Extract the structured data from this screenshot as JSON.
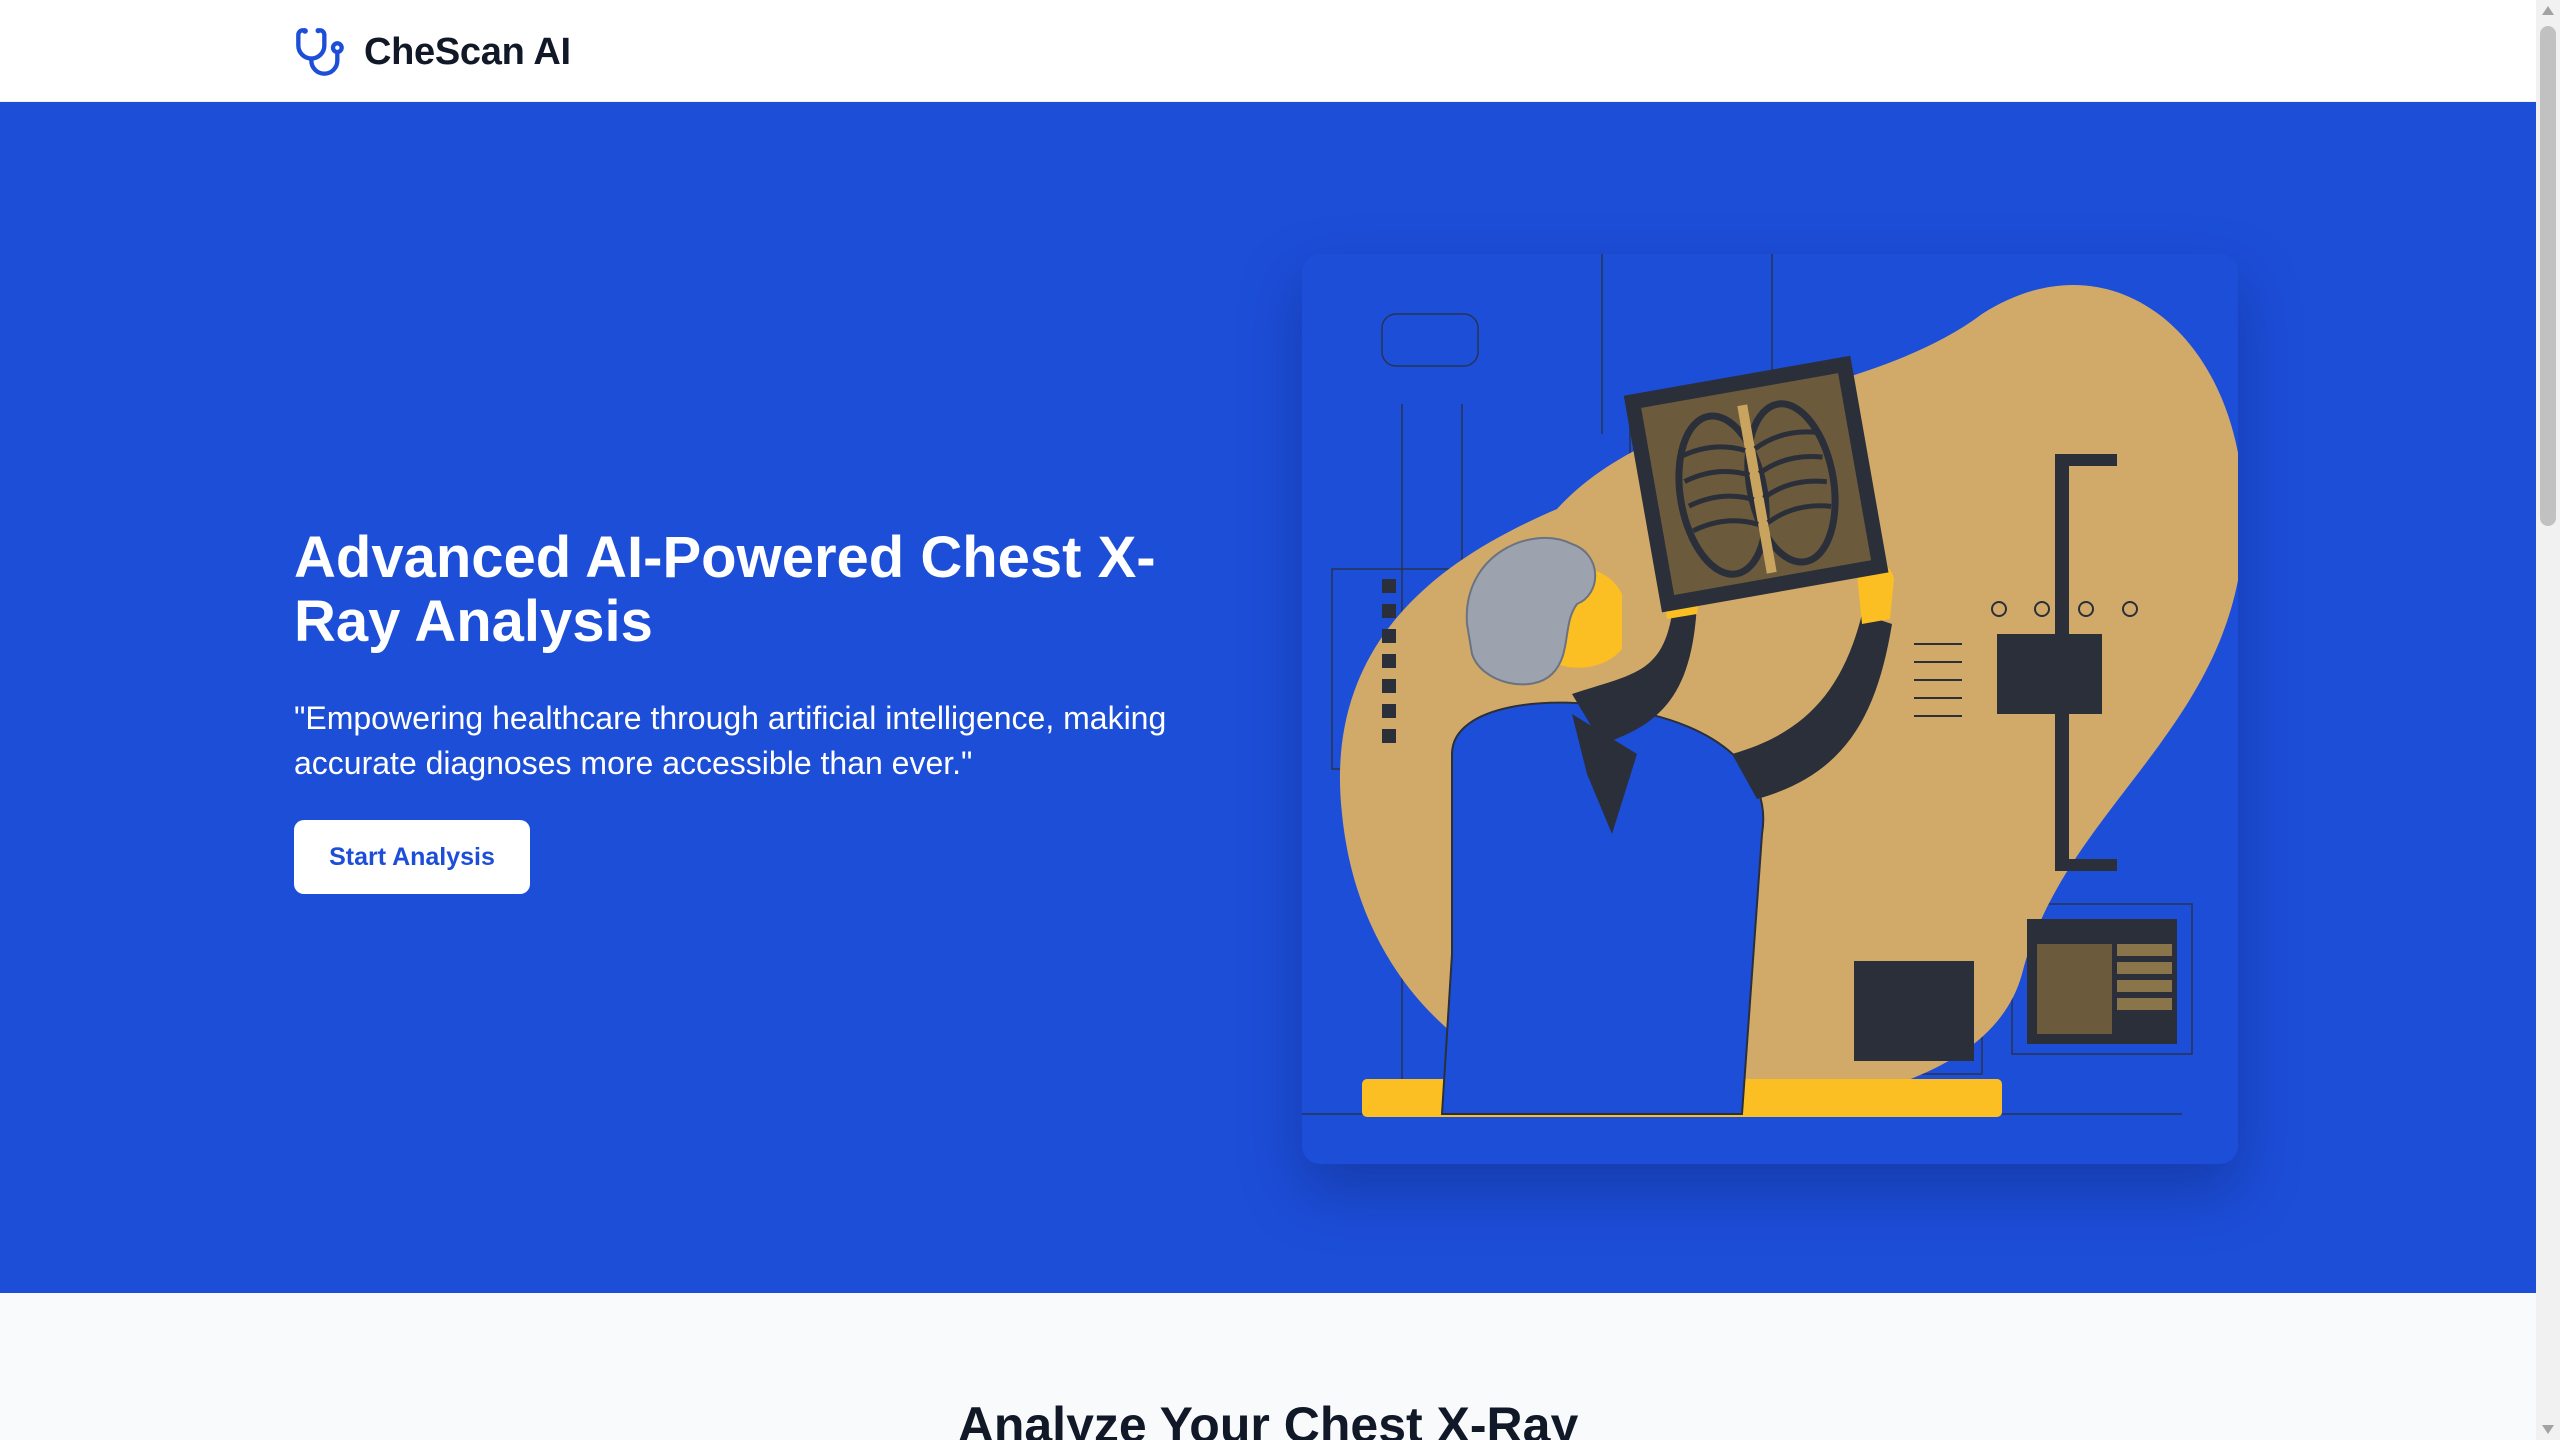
{
  "brand": {
    "name": "CheScan AI",
    "icon": "stethoscope-icon"
  },
  "hero": {
    "title": "Advanced AI-Powered Chest X-Ray Analysis",
    "subtitle": "\"Empowering healthcare through artificial intelligence, making accurate diagnoses more accessible than ever.\"",
    "cta_label": "Start Analysis",
    "illustration": "doctor-examining-chest-xray-illustration"
  },
  "analyze_section": {
    "title": "Analyze Your Chest X-Ray"
  },
  "colors": {
    "primary": "#1d4ed8",
    "illustration_blob": "#d1aa6a",
    "illustration_accent": "#fbbf24",
    "text_dark": "#111827"
  }
}
